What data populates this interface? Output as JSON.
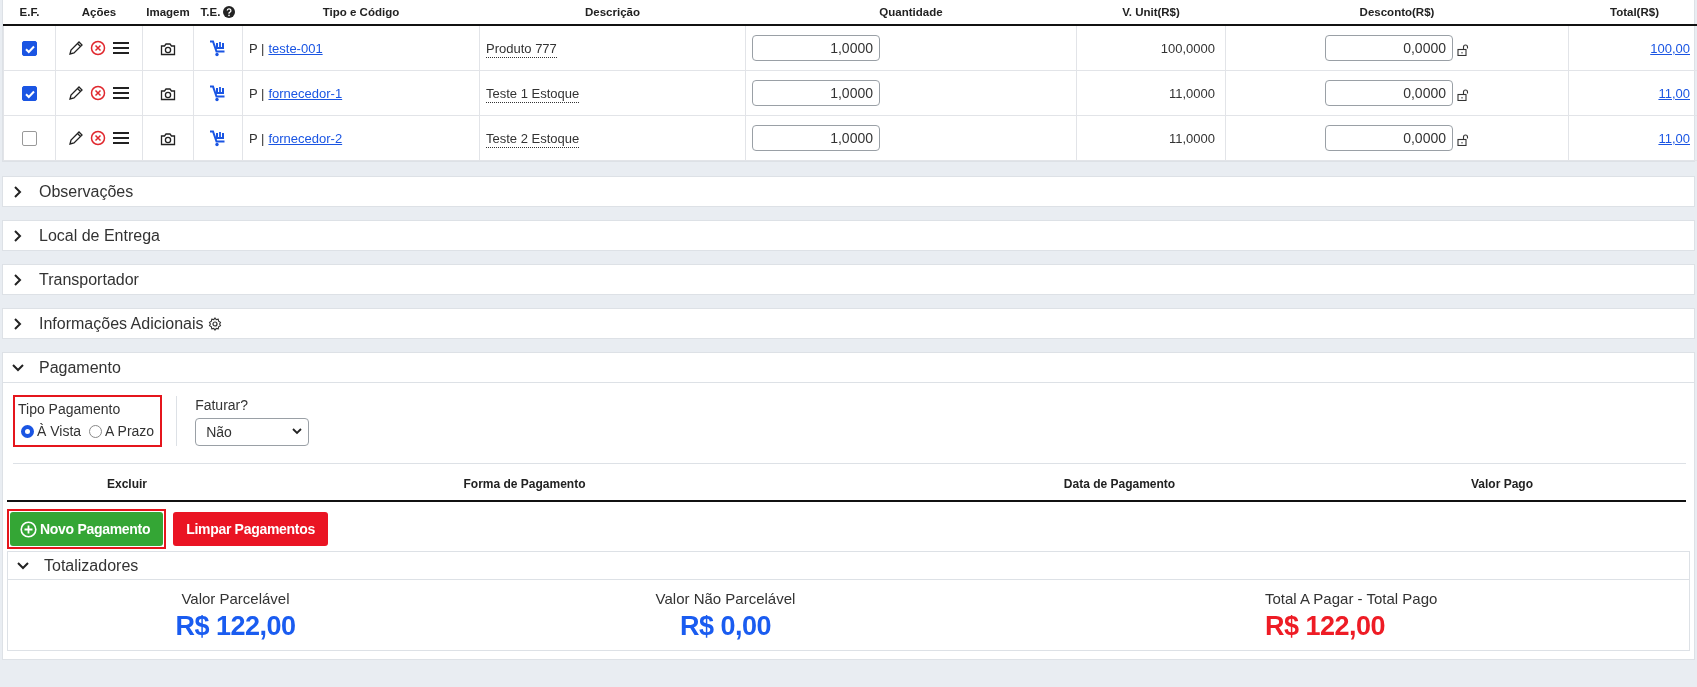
{
  "items_table": {
    "columns": [
      {
        "label": "E.F."
      },
      {
        "label": "Ações"
      },
      {
        "label": "Imagem"
      },
      {
        "label": "T.E.",
        "help": true
      },
      {
        "label": "Tipo e Código"
      },
      {
        "label": "Descrição"
      },
      {
        "label": "Quantidade"
      },
      {
        "label": "V. Unit(R$)"
      },
      {
        "label": "Desconto(R$)"
      },
      {
        "label": "Total(R$)"
      }
    ],
    "rows": [
      {
        "checked": true,
        "type": "P |",
        "code": "teste-001",
        "description": "Produto 777",
        "quantity": "1,0000",
        "unit_value": "100,0000",
        "discount": "0,0000",
        "total": "100,00"
      },
      {
        "checked": true,
        "type": "P |",
        "code": "fornecedor-1",
        "description": "Teste 1 Estoque",
        "quantity": "1,0000",
        "unit_value": "11,0000",
        "discount": "0,0000",
        "total": "11,00"
      },
      {
        "checked": false,
        "type": "P |",
        "code": "fornecedor-2",
        "description": "Teste 2 Estoque",
        "quantity": "1,0000",
        "unit_value": "11,0000",
        "discount": "0,0000",
        "total": "11,00"
      }
    ]
  },
  "sections": [
    {
      "title": "Observações",
      "expanded": false
    },
    {
      "title": "Local de Entrega",
      "expanded": false
    },
    {
      "title": "Transportador",
      "expanded": false
    },
    {
      "title": "Informações Adicionais",
      "expanded": false,
      "settings": true
    }
  ],
  "payment": {
    "title": "Pagamento",
    "expanded": true,
    "payment_type": {
      "label": "Tipo Pagamento",
      "highlighted": true,
      "options": [
        {
          "label": "À Vista",
          "selected": true
        },
        {
          "label": "A Prazo",
          "selected": false
        }
      ]
    },
    "invoice": {
      "label": "Faturar?",
      "value": "Não"
    },
    "columns": [
      "Excluir",
      "Forma de Pagamento",
      "Data de Pagamento",
      "Valor Pago"
    ],
    "buttons": [
      {
        "kind": "add",
        "label": "Novo Pagamento",
        "highlighted": true
      },
      {
        "kind": "clear",
        "label": "Limpar Pagamentos",
        "highlighted": false
      }
    ]
  },
  "totals": {
    "title": "Totalizadores",
    "expanded": true,
    "items": [
      {
        "label": "Valor Parcelável",
        "value": "R$ 122,00",
        "color": "#1a5cf0"
      },
      {
        "label": "Valor Não Parcelável",
        "value": "R$ 0,00",
        "color": "#1a5cf0"
      },
      {
        "label": "Total A Pagar - Total Pago",
        "value": "R$ 122,00",
        "color": "#ee1c25"
      }
    ]
  }
}
